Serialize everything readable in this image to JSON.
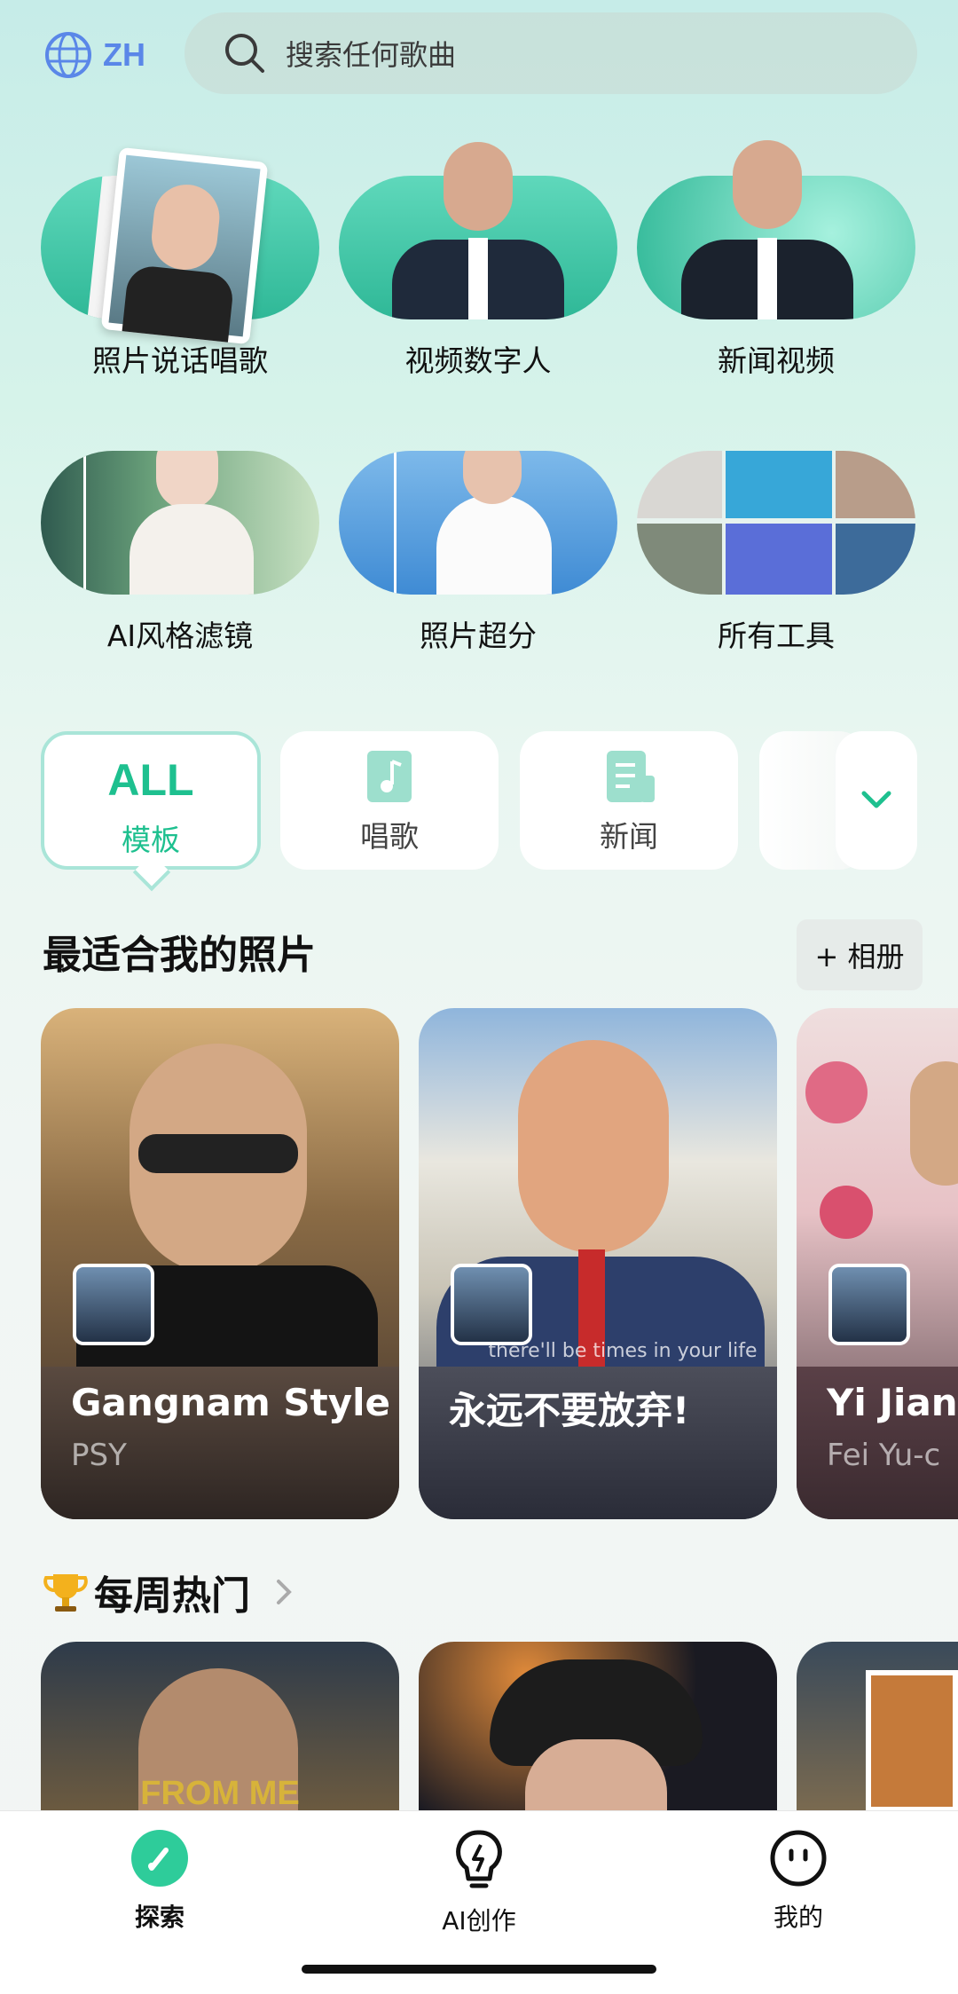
{
  "header": {
    "lang_label": "ZH",
    "search_placeholder": "搜索任何歌曲"
  },
  "tools": [
    {
      "label": "照片说话唱歌"
    },
    {
      "label": "视频数字人"
    },
    {
      "label": "新闻视频"
    },
    {
      "label": "AI风格滤镜"
    },
    {
      "label": "照片超分"
    },
    {
      "label": "所有工具"
    }
  ],
  "tabs": [
    {
      "big": "ALL",
      "label": "模板"
    },
    {
      "label": "唱歌"
    },
    {
      "label": "新闻"
    }
  ],
  "section": {
    "title": "最适合我的照片",
    "album_button": "+ 相册"
  },
  "cards": [
    {
      "title": "Gangnam Style",
      "subtitle": "PSY"
    },
    {
      "title": "永远不要放弃!",
      "subtitle": "",
      "overlay": "there'll be times in your life"
    },
    {
      "title": "Yi Jian",
      "subtitle": "Fei Yu-c"
    }
  ],
  "weekly": {
    "title": "每周热门",
    "card1_text": "FROM ME"
  },
  "nav": [
    {
      "label": "探索",
      "active": true
    },
    {
      "label": "AI创作",
      "active": false
    },
    {
      "label": "我的",
      "active": false
    }
  ],
  "colors": {
    "accent": "#2ecc9a",
    "tab_border": "#a9e5d8",
    "lang": "#5a87e8"
  }
}
